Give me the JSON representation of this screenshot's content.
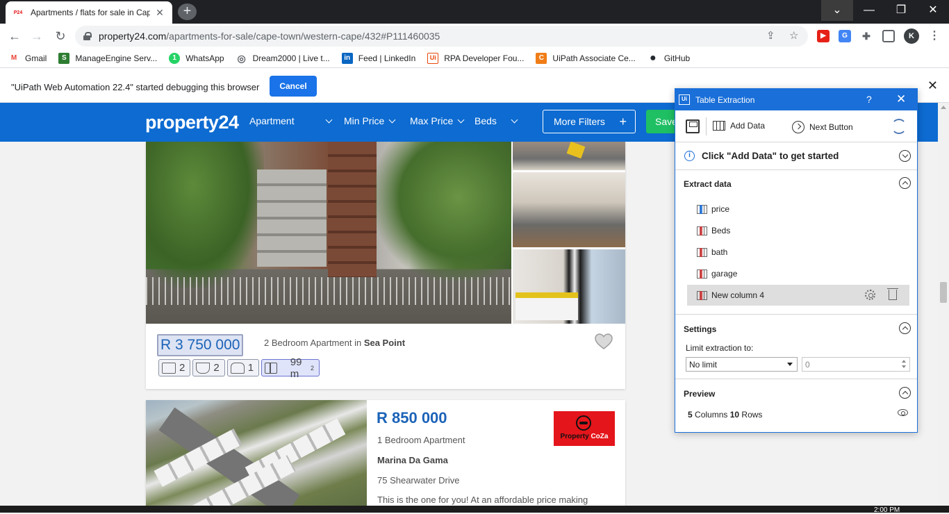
{
  "browser": {
    "tab_title": "Apartments / flats for sale in Cap",
    "tab_favicon_text": "P24",
    "url_host": "property24.com",
    "url_path": "/apartments-for-sale/cape-town/western-cape/432#P111460035",
    "profile_initial": "K"
  },
  "bookmarks": [
    {
      "label": "Gmail",
      "icon": "gmail-icon",
      "color": "#ea4335",
      "glyph": "M"
    },
    {
      "label": "ManageEngine Serv...",
      "icon": "manageengine-icon",
      "color": "#2e7d32",
      "glyph": "S"
    },
    {
      "label": "WhatsApp",
      "icon": "whatsapp-icon",
      "color": "#25d366",
      "glyph": "1"
    },
    {
      "label": "Dream2000 | Live t...",
      "icon": "globe-icon",
      "color": "#5f6368",
      "glyph": "◎"
    },
    {
      "label": "Feed | LinkedIn",
      "icon": "linkedin-icon",
      "color": "#0a66c2",
      "glyph": "in"
    },
    {
      "label": "RPA Developer Fou...",
      "icon": "uipath-icon",
      "color": "#e8470c",
      "glyph": "Ui"
    },
    {
      "label": "UiPath Associate Ce...",
      "icon": "uipath-c-icon",
      "color": "#f07d17",
      "glyph": "C"
    },
    {
      "label": "GitHub",
      "icon": "github-icon",
      "color": "#24292f",
      "glyph": "●"
    }
  ],
  "debug_bar": {
    "message": "\"UiPath Web Automation 22.4\" started debugging this browser",
    "cancel_label": "Cancel"
  },
  "site_nav": {
    "logo": "property24",
    "type_label": "Apartment",
    "min_price_label": "Min Price",
    "max_price_label": "Max Price",
    "beds_label": "Beds",
    "more_filters_label": "More Filters",
    "save_label": "Save"
  },
  "listings": [
    {
      "price": "R 3 750 000",
      "description": "2 Bedroom Apartment in ",
      "suburb": "Sea Point",
      "beds": "2",
      "baths": "2",
      "garages": "1",
      "size": "99 m",
      "size_unit_sup": "2"
    },
    {
      "price": "R 850 000",
      "bedrooms": "1 Bedroom Apartment",
      "area": "Marina Da Gama",
      "street": "75 Shearwater Drive",
      "blurb": "This is the one for you! At an affordable price making",
      "agent_brand": "Property",
      "agent_brand_suffix": "CoZa"
    }
  ],
  "panel": {
    "title": "Table Extraction",
    "help": "?",
    "add_data_label": "Add Data",
    "next_button_label": "Next Button",
    "info_text": "Click \"Add Data\" to get started",
    "extract_heading": "Extract data",
    "columns": [
      "price",
      "Beds",
      "bath",
      "garage",
      "New column 4"
    ],
    "settings_heading": "Settings",
    "limit_label": "Limit extraction to:",
    "limit_value": "No limit",
    "limit_count": "0",
    "preview_heading": "Preview",
    "preview_columns": "5",
    "preview_columns_label": " Columns ",
    "preview_rows": "10",
    "preview_rows_label": " Rows"
  },
  "taskbar": {
    "time": "2:00 PM"
  }
}
